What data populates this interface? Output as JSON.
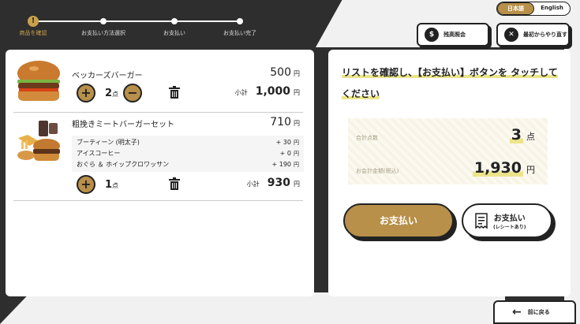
{
  "progress": {
    "steps": [
      {
        "label": "商品を確認",
        "icon": "!"
      },
      {
        "label": "お支払い方法選択"
      },
      {
        "label": "お支払い"
      },
      {
        "label": "お支払い完了"
      }
    ],
    "accent": "#c8a14c"
  },
  "language": {
    "japanese": "日本語",
    "english": "English",
    "selected": "日本語"
  },
  "header": {
    "balance_label": "残高照会",
    "restart_label": "最初からやり直す"
  },
  "cart": {
    "items": [
      {
        "name": "ベッカーズバーガー",
        "price": "500",
        "quantity": "2",
        "subtotal_label": "小計",
        "subtotal": "1,000"
      },
      {
        "name": "粗挽きミートバーガーセット",
        "price": "710",
        "options": [
          {
            "name": "ブーティーン (明太子)",
            "price": "+ 30"
          },
          {
            "name": "アイスコーヒー",
            "price": "+ 0"
          },
          {
            "name": "おぐら ＆ ホイップクロワッサン",
            "price": "+ 190"
          }
        ],
        "quantity": "1",
        "subtotal_label": "小計",
        "subtotal": "930"
      }
    ],
    "yen": "円",
    "count_unit": "点"
  },
  "summary": {
    "instruction": "リストを確認し、【お支払い】ボタンを タッチしてください",
    "total_count_label": "合計点数",
    "total_count": "3",
    "count_unit": "点",
    "total_amount_label": "お会計金額(税込)",
    "total_amount": "1,930",
    "yen": "円"
  },
  "actions": {
    "pay_label": "お支払い",
    "pay_receipt_label": "お支払い",
    "pay_receipt_sub": "(レシートあり)",
    "back_label": "前に戻る"
  }
}
